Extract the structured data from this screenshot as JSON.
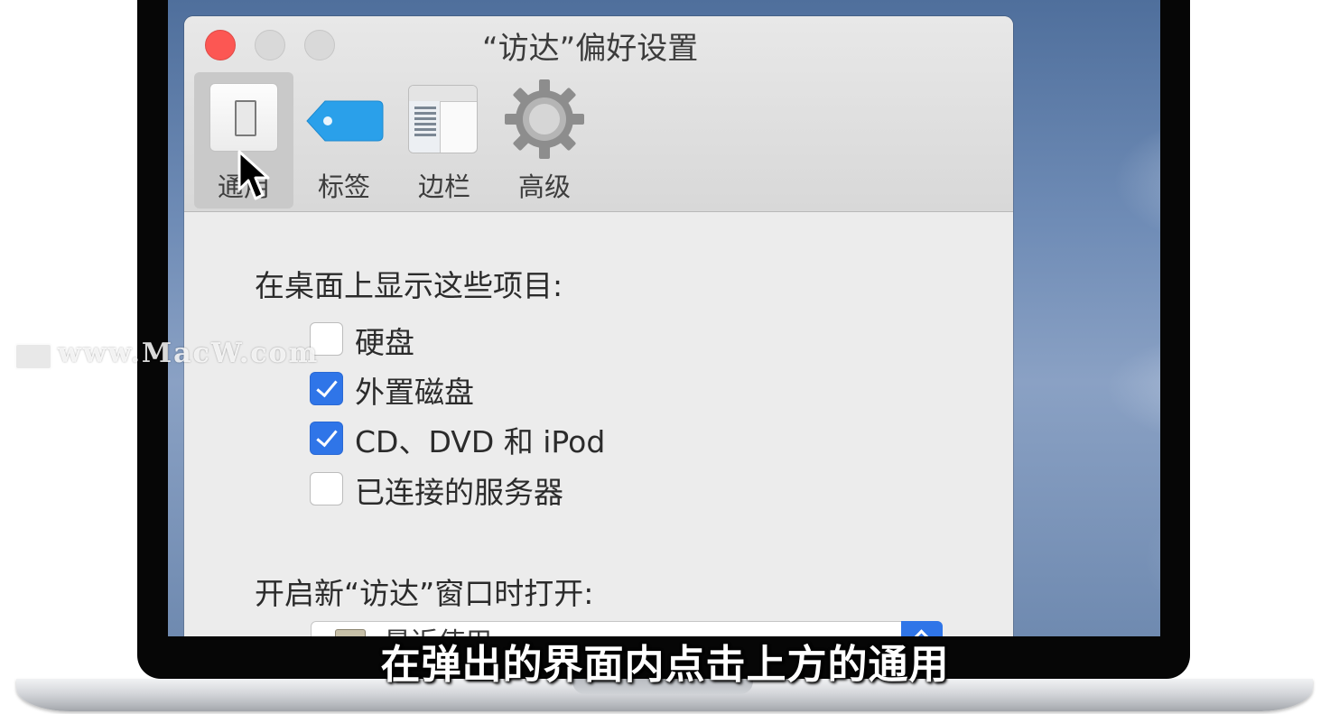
{
  "window": {
    "title": "“访达”偏好设置"
  },
  "toolbar": {
    "items": [
      {
        "label": "通用",
        "icon": "general-switch-icon",
        "selected": true
      },
      {
        "label": "标签",
        "icon": "tag-icon",
        "selected": false
      },
      {
        "label": "边栏",
        "icon": "sidebar-icon",
        "selected": false
      },
      {
        "label": "高级",
        "icon": "gear-icon",
        "selected": false
      }
    ]
  },
  "general": {
    "desktop_heading": "在桌面上显示这些项目:",
    "desktop_items": [
      {
        "label": "硬盘",
        "checked": false
      },
      {
        "label": "外置磁盘",
        "checked": true
      },
      {
        "label": "CD、DVD 和 iPod",
        "checked": true
      },
      {
        "label": "已连接的服务器",
        "checked": false
      }
    ],
    "new_window_heading": "开启新“访达”窗口时打开:",
    "new_window_value": "最近使用"
  },
  "watermark": {
    "text": "www.MacW.com"
  },
  "subtitle": {
    "text": "在弹出的界面内点击上方的通用"
  },
  "colors": {
    "close": "#fc5753",
    "accent": "#2f75e8",
    "tag": "#2aa0ea"
  }
}
